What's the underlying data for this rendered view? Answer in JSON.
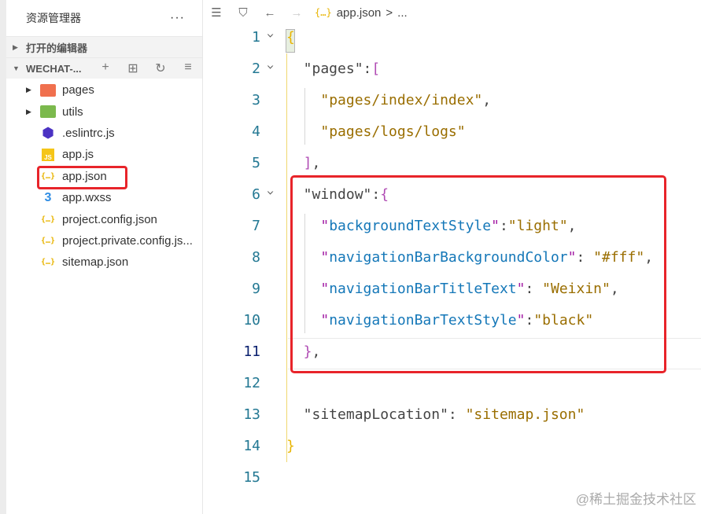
{
  "sidebar": {
    "title": "资源管理器",
    "more": "···",
    "open_editors": "打开的编辑器",
    "project": "WECHAT-...",
    "actions": [
      "+",
      "⊞",
      "↻",
      "≡"
    ],
    "files": [
      {
        "name": "pages",
        "icon": "folder-pages-icon",
        "cls": "folder-p",
        "glyph": "",
        "arrow": "▶"
      },
      {
        "name": "utils",
        "icon": "folder-utils-icon",
        "cls": "folder-u",
        "glyph": "",
        "arrow": "▶"
      },
      {
        "name": ".eslintrc.js",
        "icon": "eslint-icon",
        "cls": "eslint",
        "glyph": "⬢",
        "arrow": ""
      },
      {
        "name": "app.js",
        "icon": "js-file-icon",
        "cls": "js",
        "glyph": "JS",
        "arrow": ""
      },
      {
        "name": "app.json",
        "icon": "json-file-icon",
        "cls": "json",
        "glyph": "{…}",
        "arrow": ""
      },
      {
        "name": "app.wxss",
        "icon": "css-file-icon",
        "cls": "css",
        "glyph": "3",
        "arrow": ""
      },
      {
        "name": "project.config.json",
        "icon": "json-file-icon",
        "cls": "json",
        "glyph": "{…}",
        "arrow": ""
      },
      {
        "name": "project.private.config.js...",
        "icon": "json-file-icon",
        "cls": "json",
        "glyph": "{…}",
        "arrow": ""
      },
      {
        "name": "sitemap.json",
        "icon": "json-file-icon",
        "cls": "json",
        "glyph": "{…}",
        "arrow": ""
      }
    ]
  },
  "toolbar": {
    "list": "☰",
    "bookmark": "⛉",
    "back": "←",
    "forward": "→",
    "crumb_icon": "{…}",
    "crumb_file": "app.json",
    "crumb_sep": ">",
    "crumb_more": "..."
  },
  "editor": {
    "current_line": 11,
    "folds": [
      1,
      2,
      6
    ],
    "lines": [
      {
        "n": "1",
        "indent": 0,
        "tokens": [
          [
            "{",
            "brace"
          ]
        ]
      },
      {
        "n": "2",
        "indent": 2,
        "tokens": [
          [
            "\"pages\"",
            "key"
          ],
          [
            ":",
            "p"
          ],
          [
            "[",
            "bracket"
          ]
        ]
      },
      {
        "n": "3",
        "indent": 4,
        "tokens": [
          [
            "\"pages/index/index\"",
            "str"
          ],
          [
            ",",
            "p"
          ]
        ]
      },
      {
        "n": "4",
        "indent": 4,
        "tokens": [
          [
            "\"pages/logs/logs\"",
            "str"
          ]
        ]
      },
      {
        "n": "5",
        "indent": 2,
        "tokens": [
          [
            "]",
            "bracket"
          ],
          [
            ",",
            "p"
          ]
        ]
      },
      {
        "n": "6",
        "indent": 2,
        "tokens": [
          [
            "\"window\"",
            "key"
          ],
          [
            ":",
            "p"
          ],
          [
            "{",
            "bracket"
          ]
        ]
      },
      {
        "n": "7",
        "indent": 4,
        "tokens": [
          [
            "\"",
            "q"
          ],
          [
            "backgroundTextStyle",
            "key2"
          ],
          [
            "\"",
            "q"
          ],
          [
            ":",
            "p"
          ],
          [
            "\"light\"",
            "str"
          ],
          [
            ",",
            "p"
          ]
        ]
      },
      {
        "n": "8",
        "indent": 4,
        "tokens": [
          [
            "\"",
            "q"
          ],
          [
            "navigationBarBackgroundColor",
            "key2"
          ],
          [
            "\"",
            "q"
          ],
          [
            ": ",
            "p"
          ],
          [
            "\"#fff\"",
            "str"
          ],
          [
            ",",
            "p"
          ]
        ]
      },
      {
        "n": "9",
        "indent": 4,
        "tokens": [
          [
            "\"",
            "q"
          ],
          [
            "navigationBarTitleText",
            "key2"
          ],
          [
            "\"",
            "q"
          ],
          [
            ": ",
            "p"
          ],
          [
            "\"Weixin\"",
            "str"
          ],
          [
            ",",
            "p"
          ]
        ]
      },
      {
        "n": "10",
        "indent": 4,
        "tokens": [
          [
            "\"",
            "q"
          ],
          [
            "navigationBarTextStyle",
            "key2"
          ],
          [
            "\"",
            "q"
          ],
          [
            ":",
            "p"
          ],
          [
            "\"black\"",
            "str"
          ]
        ]
      },
      {
        "n": "11",
        "indent": 2,
        "tokens": [
          [
            "}",
            "bracket"
          ],
          [
            ",",
            "p"
          ]
        ]
      },
      {
        "n": "12",
        "indent": 0,
        "tokens": []
      },
      {
        "n": "13",
        "indent": 2,
        "tokens": [
          [
            "\"sitemapLocation\"",
            "key"
          ],
          [
            ": ",
            "p"
          ],
          [
            "\"sitemap.json\"",
            "str"
          ]
        ]
      },
      {
        "n": "14",
        "indent": 0,
        "tokens": [
          [
            "}",
            "brace"
          ]
        ]
      },
      {
        "n": "15",
        "indent": 0,
        "tokens": []
      }
    ]
  },
  "watermark": "@稀土掘金技术社区",
  "colors": {
    "highlight": "#e8242a",
    "key": "#1477b8",
    "string": "#9a6e00"
  }
}
